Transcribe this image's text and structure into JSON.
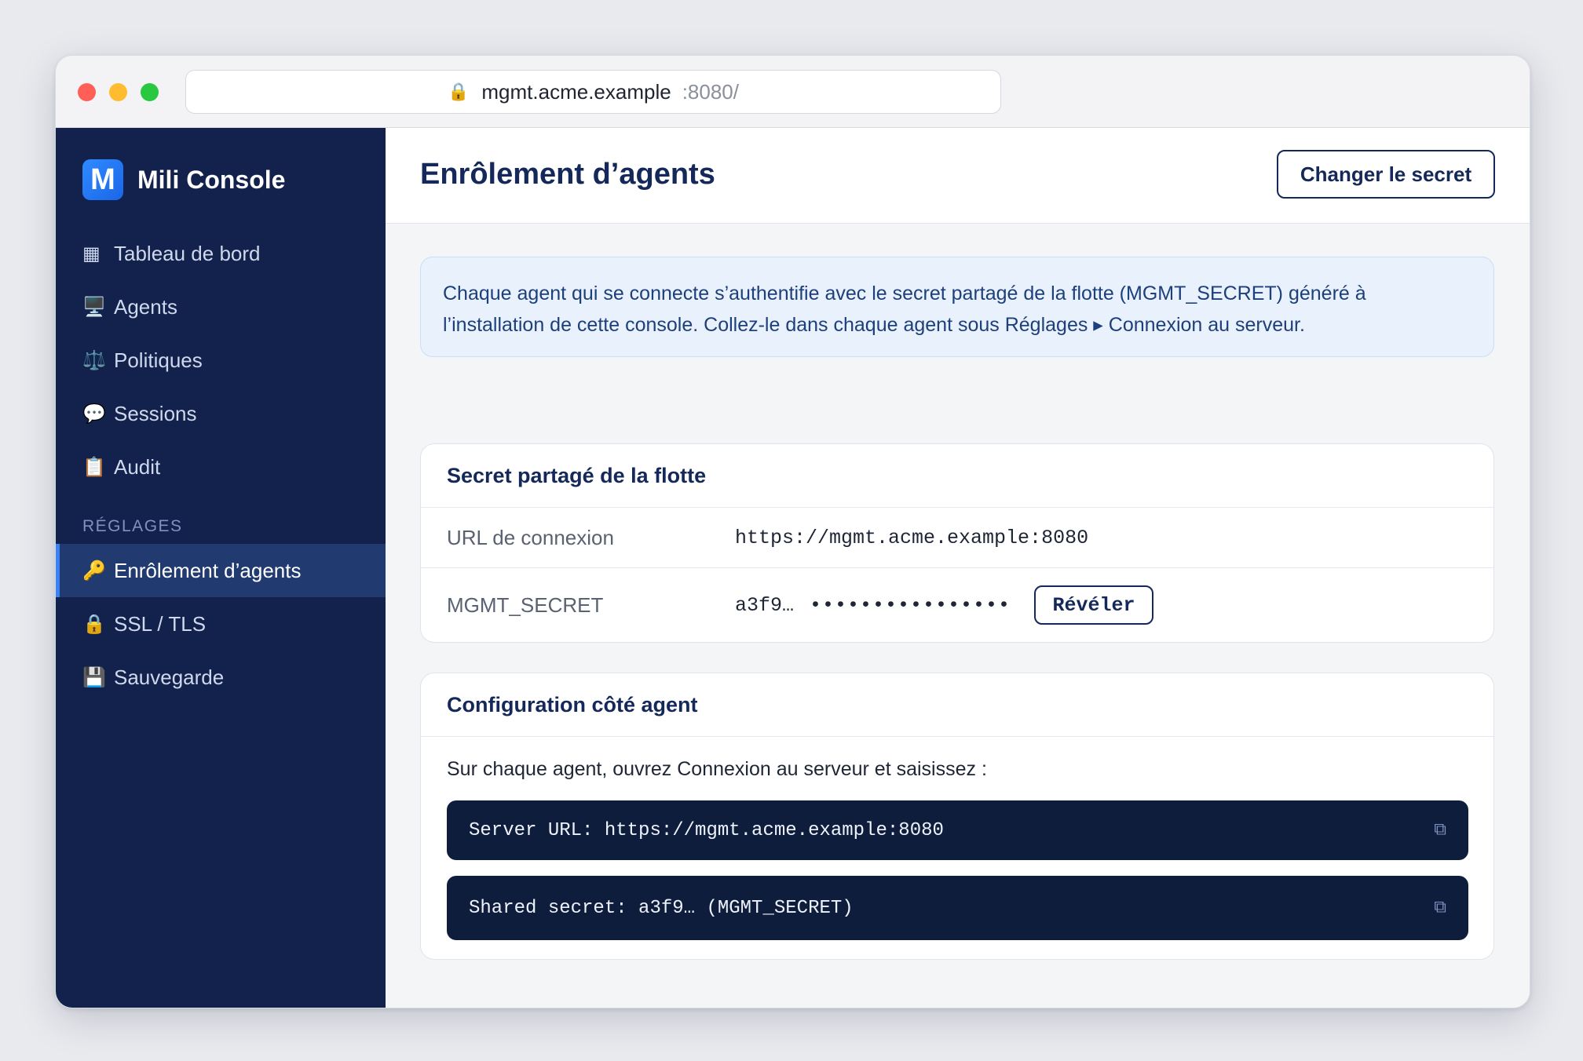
{
  "browser": {
    "url_host": "mgmt.acme.example",
    "url_port": ":8080/",
    "lock_icon": "🔒"
  },
  "sidebar": {
    "brand_logo": "M",
    "brand_name": "Mili Console",
    "items": [
      {
        "icon": "▦",
        "label": "Tableau de bord"
      },
      {
        "icon": "🖥️",
        "label": "Agents"
      },
      {
        "icon": "⚖️",
        "label": "Politiques"
      },
      {
        "icon": "💬",
        "label": "Sessions"
      },
      {
        "icon": "📋",
        "label": "Audit"
      }
    ],
    "section_label": "RÉGLAGES",
    "settings_items": [
      {
        "icon": "🔑",
        "label": "Enrôlement d’agents",
        "active": true
      },
      {
        "icon": "🔒",
        "label": "SSL / TLS"
      },
      {
        "icon": "💾",
        "label": "Sauvegarde"
      }
    ]
  },
  "header": {
    "title": "Enrôlement d’agents",
    "change_secret_label": "Changer le secret"
  },
  "info_box": {
    "text": "Chaque agent qui se connecte s’authentifie avec le secret partagé de la flotte (MGMT_SECRET) généré à l’installation de cette console. Collez-le dans chaque agent sous Réglages ▸ Connexion au serveur."
  },
  "secret_card": {
    "title": "Secret partagé de la flotte",
    "url_label": "URL de connexion",
    "url_value": "https://mgmt.acme.example:8080",
    "secret_label": "MGMT_SECRET",
    "secret_prefix": "a3f9…",
    "secret_mask": "••••••••••••••••",
    "reveal_label": "Révéler"
  },
  "agent_card": {
    "title": "Configuration côté agent",
    "instruction": "Sur chaque agent, ouvrez Connexion au serveur et saisissez :",
    "code_lines": [
      "Server URL: https://mgmt.acme.example:8080",
      "Shared secret: a3f9… (MGMT_SECRET)"
    ],
    "copy_icon": "⧉"
  }
}
